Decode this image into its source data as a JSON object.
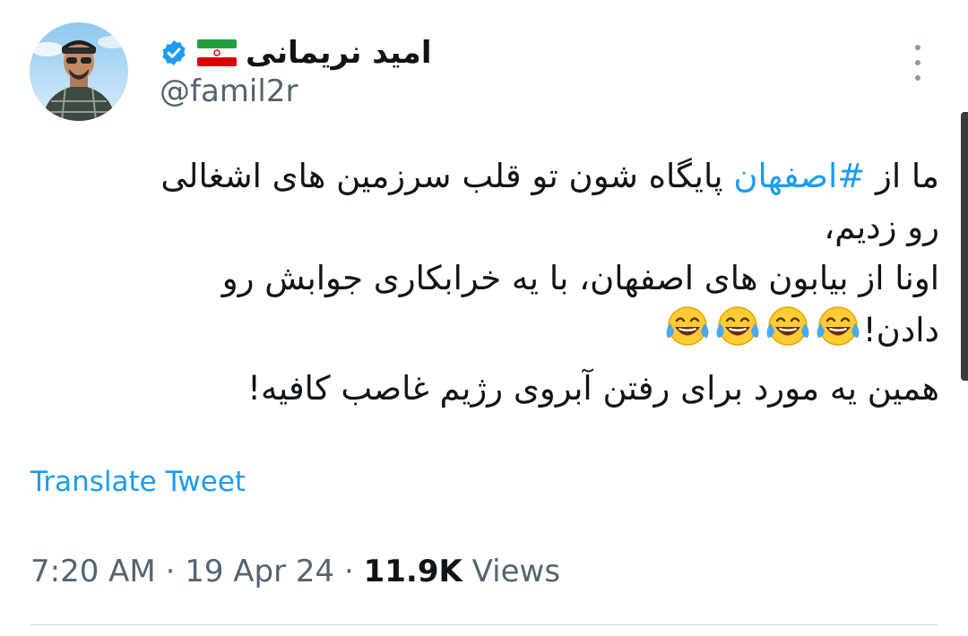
{
  "author": {
    "display_name": "امید نریمانی",
    "handle": "@famil2r",
    "verified_icon": "verified-badge-icon",
    "flag_icon": "iran-flag-icon"
  },
  "tweet": {
    "lines": [
      {
        "prefix": "ما از ",
        "hashtag": "#اصفهان",
        "suffix": "  پایگاه شون تو قلب سرزمین های اشغالی"
      },
      {
        "text": "رو زدیم،"
      },
      {
        "text": "اونا از بیابون های اصفهان، با یه خرابکاری جوابش رو"
      },
      {
        "text": "دادن!",
        "emoji": "face-with-tears-of-joy-icon",
        "emoji_count": 4
      },
      {
        "text": "همین یه مورد برای رفتن آبروی رژیم غاصب کافیه!"
      }
    ]
  },
  "translate_label": "Translate Tweet",
  "meta": {
    "time": "7:20 AM",
    "separator": " · ",
    "date": "19 Apr 24",
    "views_count": "11.9K",
    "views_label": " Views"
  },
  "colors": {
    "link": "#1d9bf0",
    "secondary_text": "#536471",
    "primary_text": "#0f1419",
    "divider": "#cfd9de"
  }
}
